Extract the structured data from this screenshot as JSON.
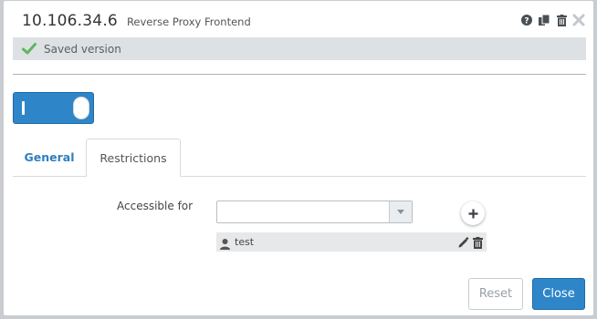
{
  "header": {
    "ip": "10.106.34.6",
    "subtitle": "Reverse Proxy Frontend",
    "icons": [
      "help-icon",
      "copy-icon",
      "trash-icon",
      "close-icon"
    ]
  },
  "status": {
    "text": "Saved version",
    "icon": "check-icon",
    "color": "#5cb85c"
  },
  "toggle": {
    "state": "on",
    "color": "#2e86c9"
  },
  "tabs": [
    {
      "label": "General",
      "active": false
    },
    {
      "label": "Restrictions",
      "active": true
    }
  ],
  "restrictions": {
    "label": "Accessible for",
    "select_value": "",
    "entries": [
      {
        "icon": "user-icon",
        "name": "test"
      }
    ]
  },
  "footer": {
    "reset_label": "Reset",
    "close_label": "Close"
  },
  "colors": {
    "accent": "#2e86c9",
    "tab_active_text": "#2e7fbf",
    "status_bg": "#dde1e4"
  }
}
